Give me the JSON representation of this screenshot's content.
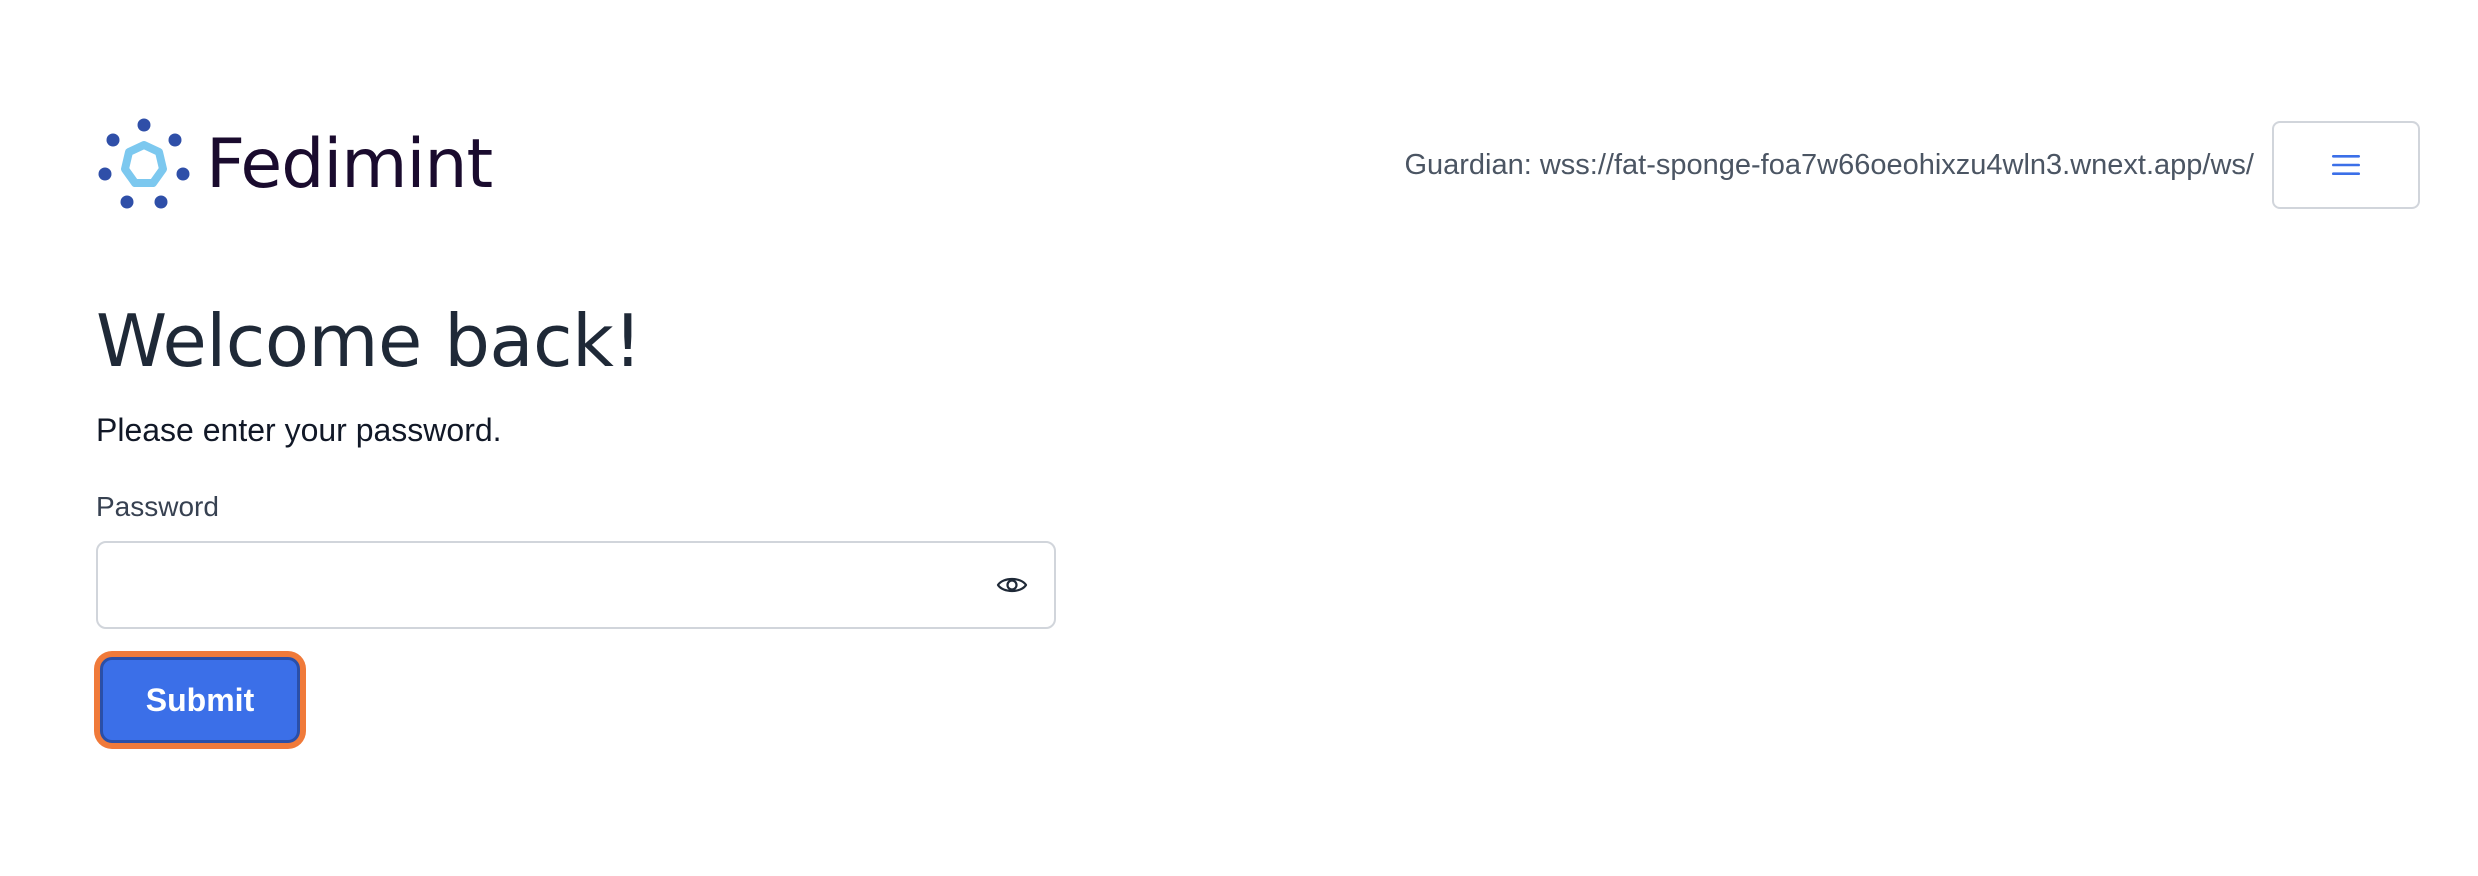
{
  "header": {
    "brand_name": "Fedimint",
    "guardian_text": "Guardian: wss://fat-sponge-foa7w66oeohixzu4wln3.wnext.app/ws/",
    "menu_icon": "hamburger-menu-icon",
    "logo_icon": "fedimint-logo-icon"
  },
  "main": {
    "title": "Welcome back!",
    "subtitle": "Please enter your password.",
    "password_label": "Password",
    "password_value": "",
    "password_placeholder": "",
    "visibility_icon": "eye-icon",
    "submit_label": "Submit"
  },
  "colors": {
    "accent": "#3b6fe8",
    "focus_ring": "#f07a3a",
    "logo_light": "#7cc8ef",
    "logo_dark": "#2f4fa8"
  }
}
